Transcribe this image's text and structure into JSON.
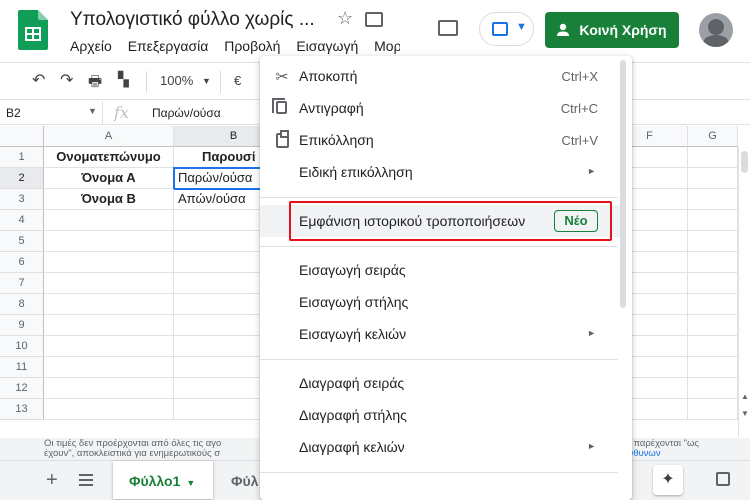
{
  "app": {
    "title": "Υπολογιστικό φύλλο χωρίς ...",
    "menus": [
      "Αρχείο",
      "Επεξεργασία",
      "Προβολή",
      "Εισαγωγή",
      "Μορ"
    ],
    "share_label": "Κοινή Χρήση",
    "colors": {
      "brand_green": "#188038",
      "highlight_red": "#e8101b",
      "selection_blue": "#1a73e8"
    }
  },
  "toolbar": {
    "zoom": "100%",
    "currency": "€"
  },
  "formula_bar": {
    "cell_ref": "B2",
    "fx_label": "fx",
    "value": "Παρών/ούσα"
  },
  "grid": {
    "columns": [
      "A",
      "B",
      "F",
      "G"
    ],
    "rows": [
      "1",
      "2",
      "3",
      "4",
      "5",
      "6",
      "7",
      "8",
      "9",
      "10",
      "11",
      "12",
      "13"
    ],
    "cells": {
      "a1": "Ονοματεπώνυμο",
      "b1": "Παρουσί",
      "a2": "Όνομα Α",
      "b2": "Παρών/ούσα",
      "a3": "Όνομα Β",
      "b3": "Απών/ούσα"
    }
  },
  "notice": {
    "line1": "Οι τιμές δεν προέρχονται από όλες τις αγο",
    "line2": "έχουν\", αποκλειστικά για ενημερωτικούς σ",
    "right1": "ές παρέχονται \"ως",
    "right2": "υθυνων"
  },
  "sheet_tabs": {
    "add": "+",
    "active": "Φύλλο1",
    "other": "Φύλ"
  },
  "context_menu": {
    "items": [
      {
        "label": "Αποκοπή",
        "shortcut": "Ctrl+X",
        "icon": "scissors-icon"
      },
      {
        "label": "Αντιγραφή",
        "shortcut": "Ctrl+C",
        "icon": "copy-icon"
      },
      {
        "label": "Επικόλληση",
        "shortcut": "Ctrl+V",
        "icon": "paste-icon"
      },
      {
        "label": "Ειδική επικόλληση",
        "submenu": "►"
      },
      {
        "label": "Εμφάνιση ιστορικού τροποποιήσεων",
        "badge": "Νέο"
      },
      {
        "label": "Εισαγωγή σειράς"
      },
      {
        "label": "Εισαγωγή στήλης"
      },
      {
        "label": "Εισαγωγή κελιών",
        "submenu": "►"
      },
      {
        "label": "Διαγραφή σειράς"
      },
      {
        "label": "Διαγραφή στήλης"
      },
      {
        "label": "Διαγραφή κελιών",
        "submenu": "►"
      }
    ]
  }
}
